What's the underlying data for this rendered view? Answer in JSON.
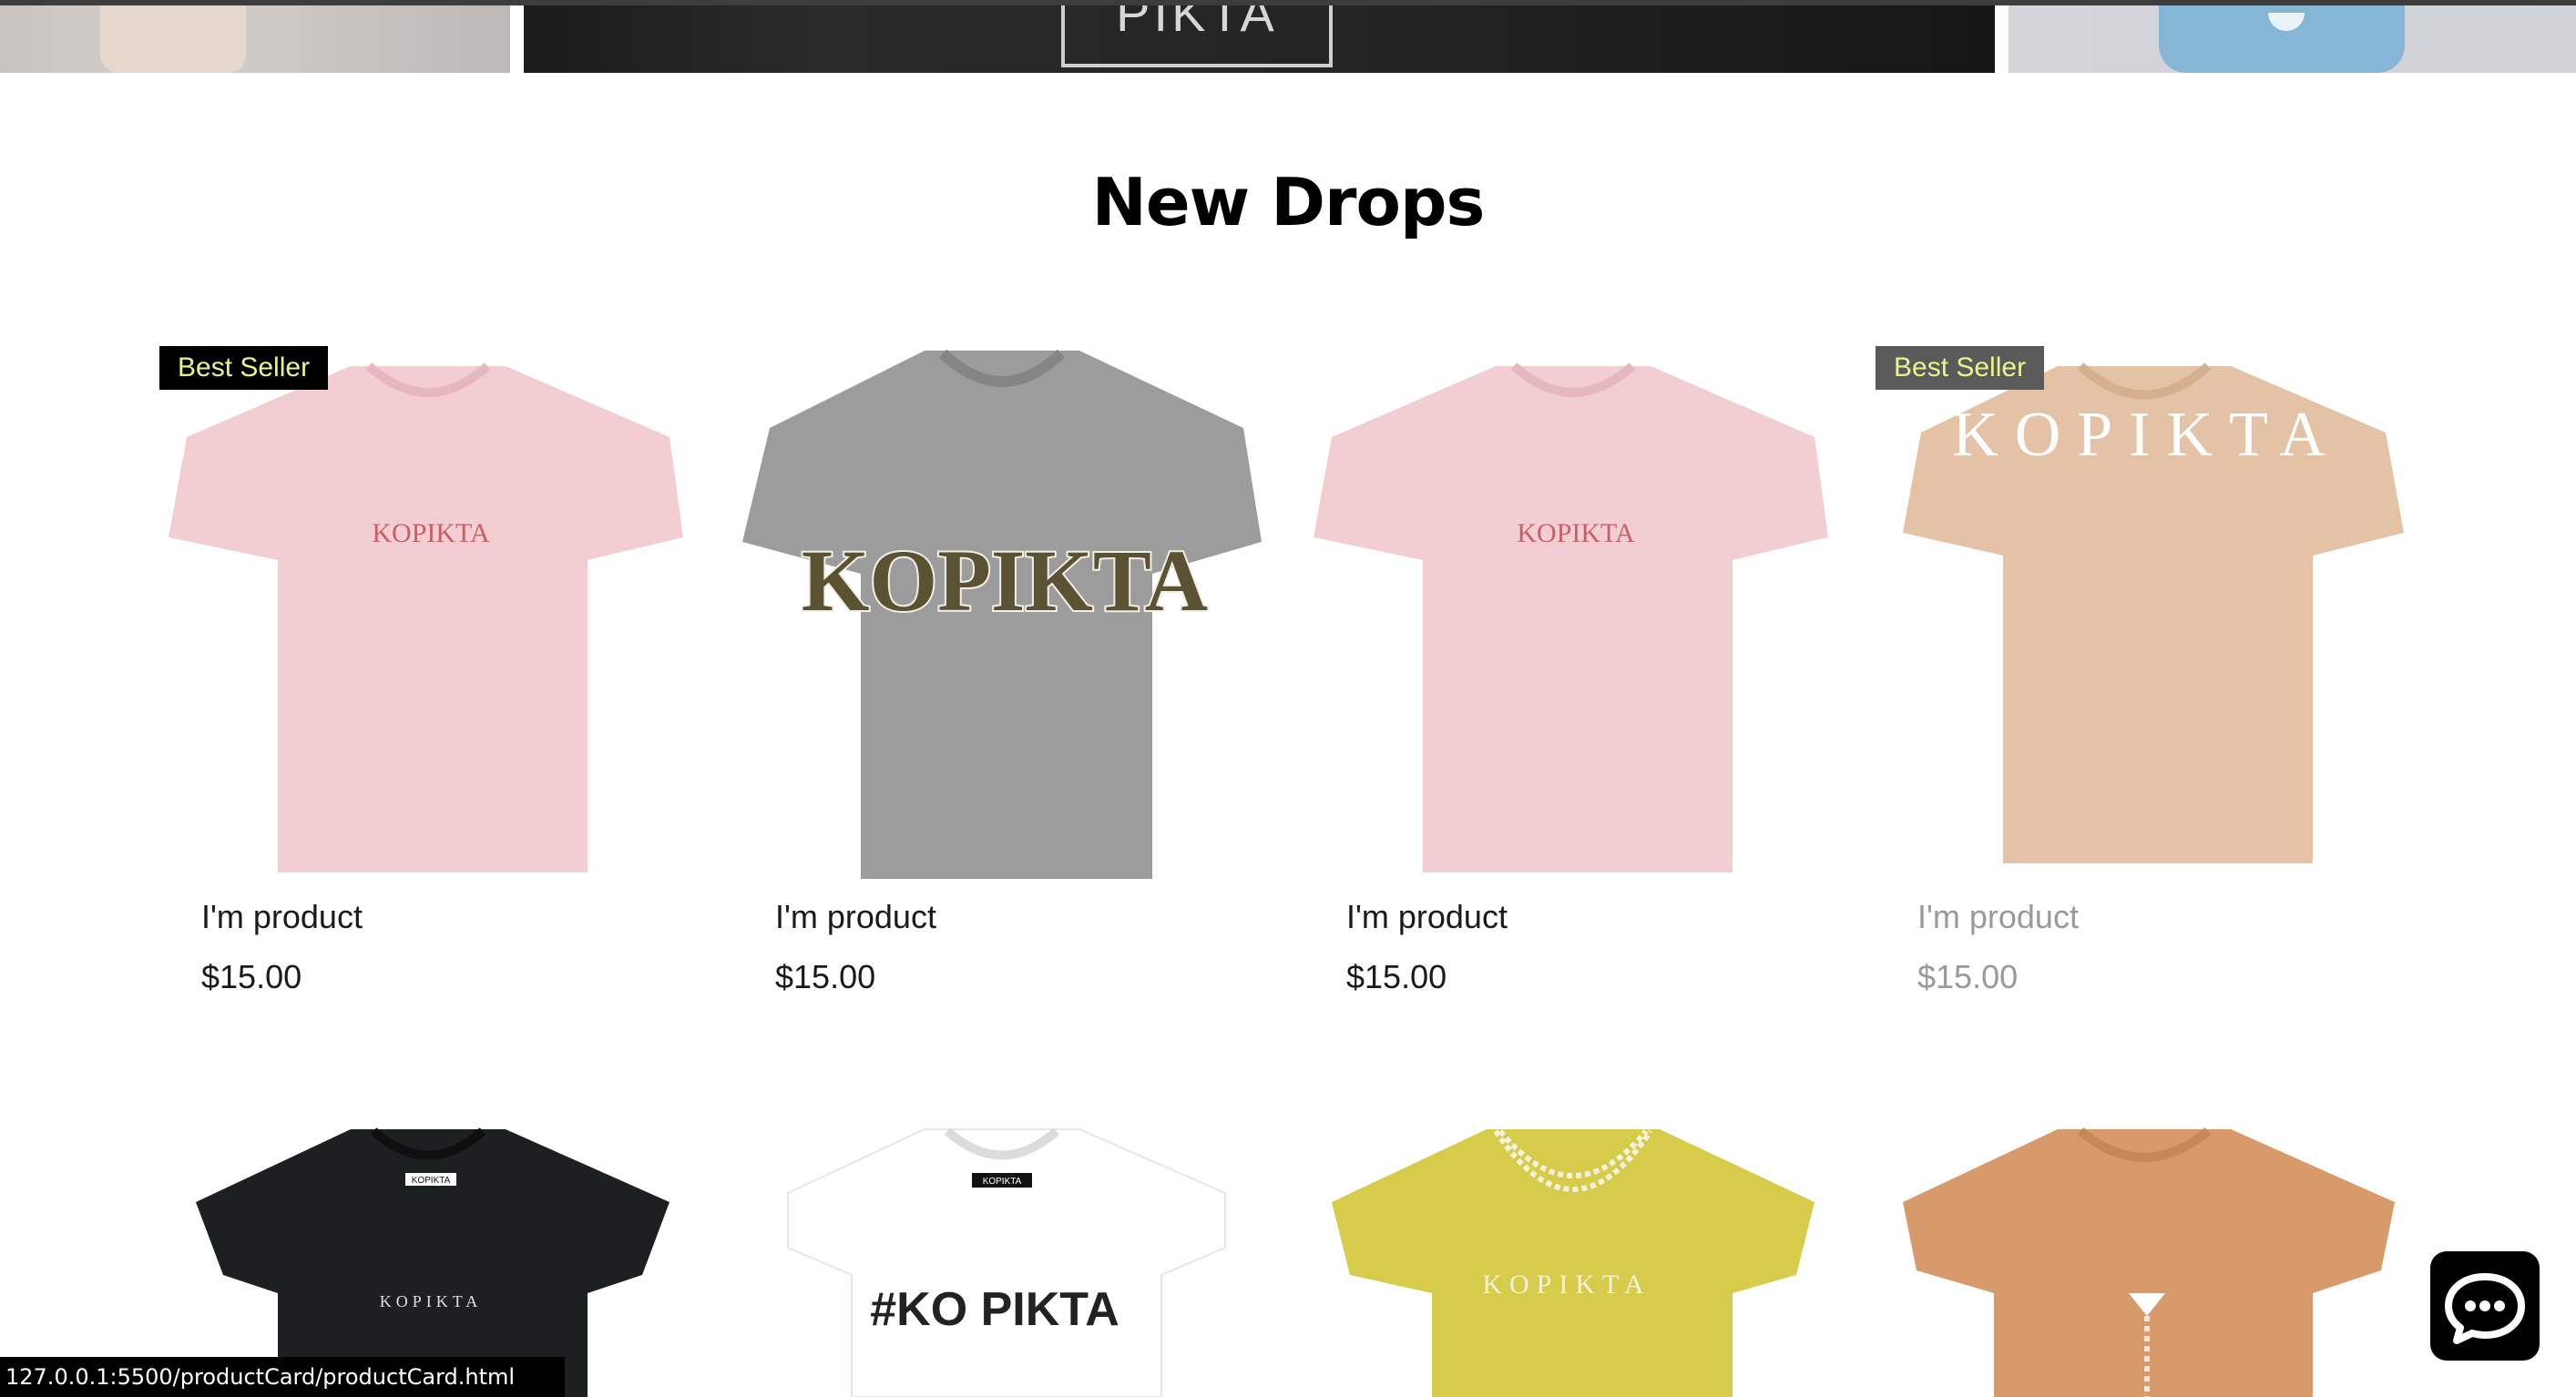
{
  "banner": {
    "center_text": "PIKTA"
  },
  "section": {
    "title": "New Drops"
  },
  "products_row1": [
    {
      "badge": "Best Seller",
      "name": "I'm product",
      "price": "$15.00",
      "shirt_color": "#f2cdd2",
      "print": "KOPIKTA"
    },
    {
      "badge": "",
      "name": "I'm product",
      "price": "$15.00",
      "shirt_color": "#9a9a9a",
      "print": "KOPIKTA"
    },
    {
      "badge": "",
      "name": "I'm product",
      "price": "$15.00",
      "shirt_color": "#f2cdd2",
      "print": "KOPIKTA"
    },
    {
      "badge": "Best Seller",
      "name": "I'm product",
      "price": "$15.00",
      "shirt_color": "#e3c2a6",
      "print": "KOPIKTA"
    }
  ],
  "products_row2": [
    {
      "shirt_color": "#1c2020",
      "print": "KOPIKTA",
      "neck_label": "KOPIKTA"
    },
    {
      "shirt_color": "#ffffff",
      "print": "#KO PIKTA",
      "neck_label": "KOPIKTA"
    },
    {
      "shirt_color": "#d6cb4a",
      "print": "KOPIKTA"
    },
    {
      "shirt_color": "#d89a6a",
      "print": ""
    }
  ],
  "status_bar": {
    "url": "127.0.0.1:5500/productCard/productCard.html"
  },
  "icons": {
    "chat": "chat-bubble-icon"
  }
}
